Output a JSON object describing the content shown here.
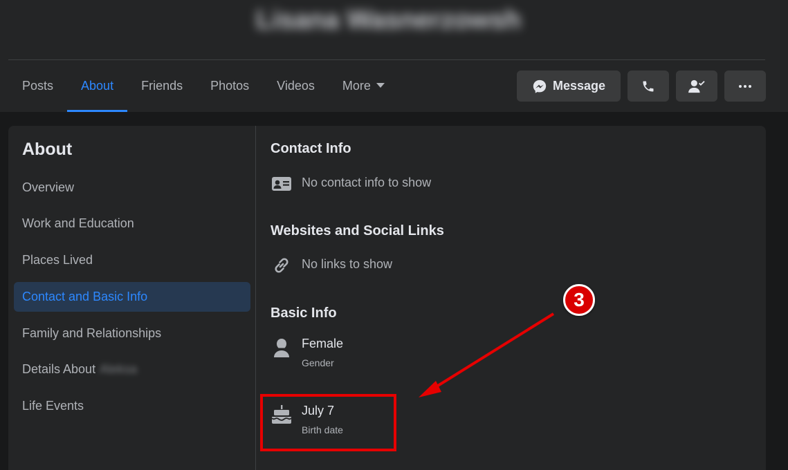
{
  "profile": {
    "name": "Lisana Wasnerzowsh"
  },
  "tabs": [
    {
      "label": "Posts"
    },
    {
      "label": "About"
    },
    {
      "label": "Friends"
    },
    {
      "label": "Photos"
    },
    {
      "label": "Videos"
    },
    {
      "label": "More"
    }
  ],
  "actions": {
    "message_label": "Message"
  },
  "about": {
    "title": "About",
    "items": [
      {
        "label": "Overview"
      },
      {
        "label": "Work and Education"
      },
      {
        "label": "Places Lived"
      },
      {
        "label": "Contact and Basic Info"
      },
      {
        "label": "Family and Relationships"
      },
      {
        "label": "Details About",
        "name": "Aleksa"
      },
      {
        "label": "Life Events"
      }
    ]
  },
  "contact": {
    "title": "Contact Info",
    "empty_text": "No contact info to show"
  },
  "links": {
    "title": "Websites and Social Links",
    "empty_text": "No links to show"
  },
  "basic_info": {
    "title": "Basic Info",
    "gender_value": "Female",
    "gender_label": "Gender",
    "birth_value": "July 7",
    "birth_label": "Birth date"
  },
  "annotation": {
    "step_number": "3",
    "color": "#e60000"
  },
  "colors": {
    "accent": "#2d88ff",
    "surface": "#242526",
    "background": "#18191a"
  }
}
